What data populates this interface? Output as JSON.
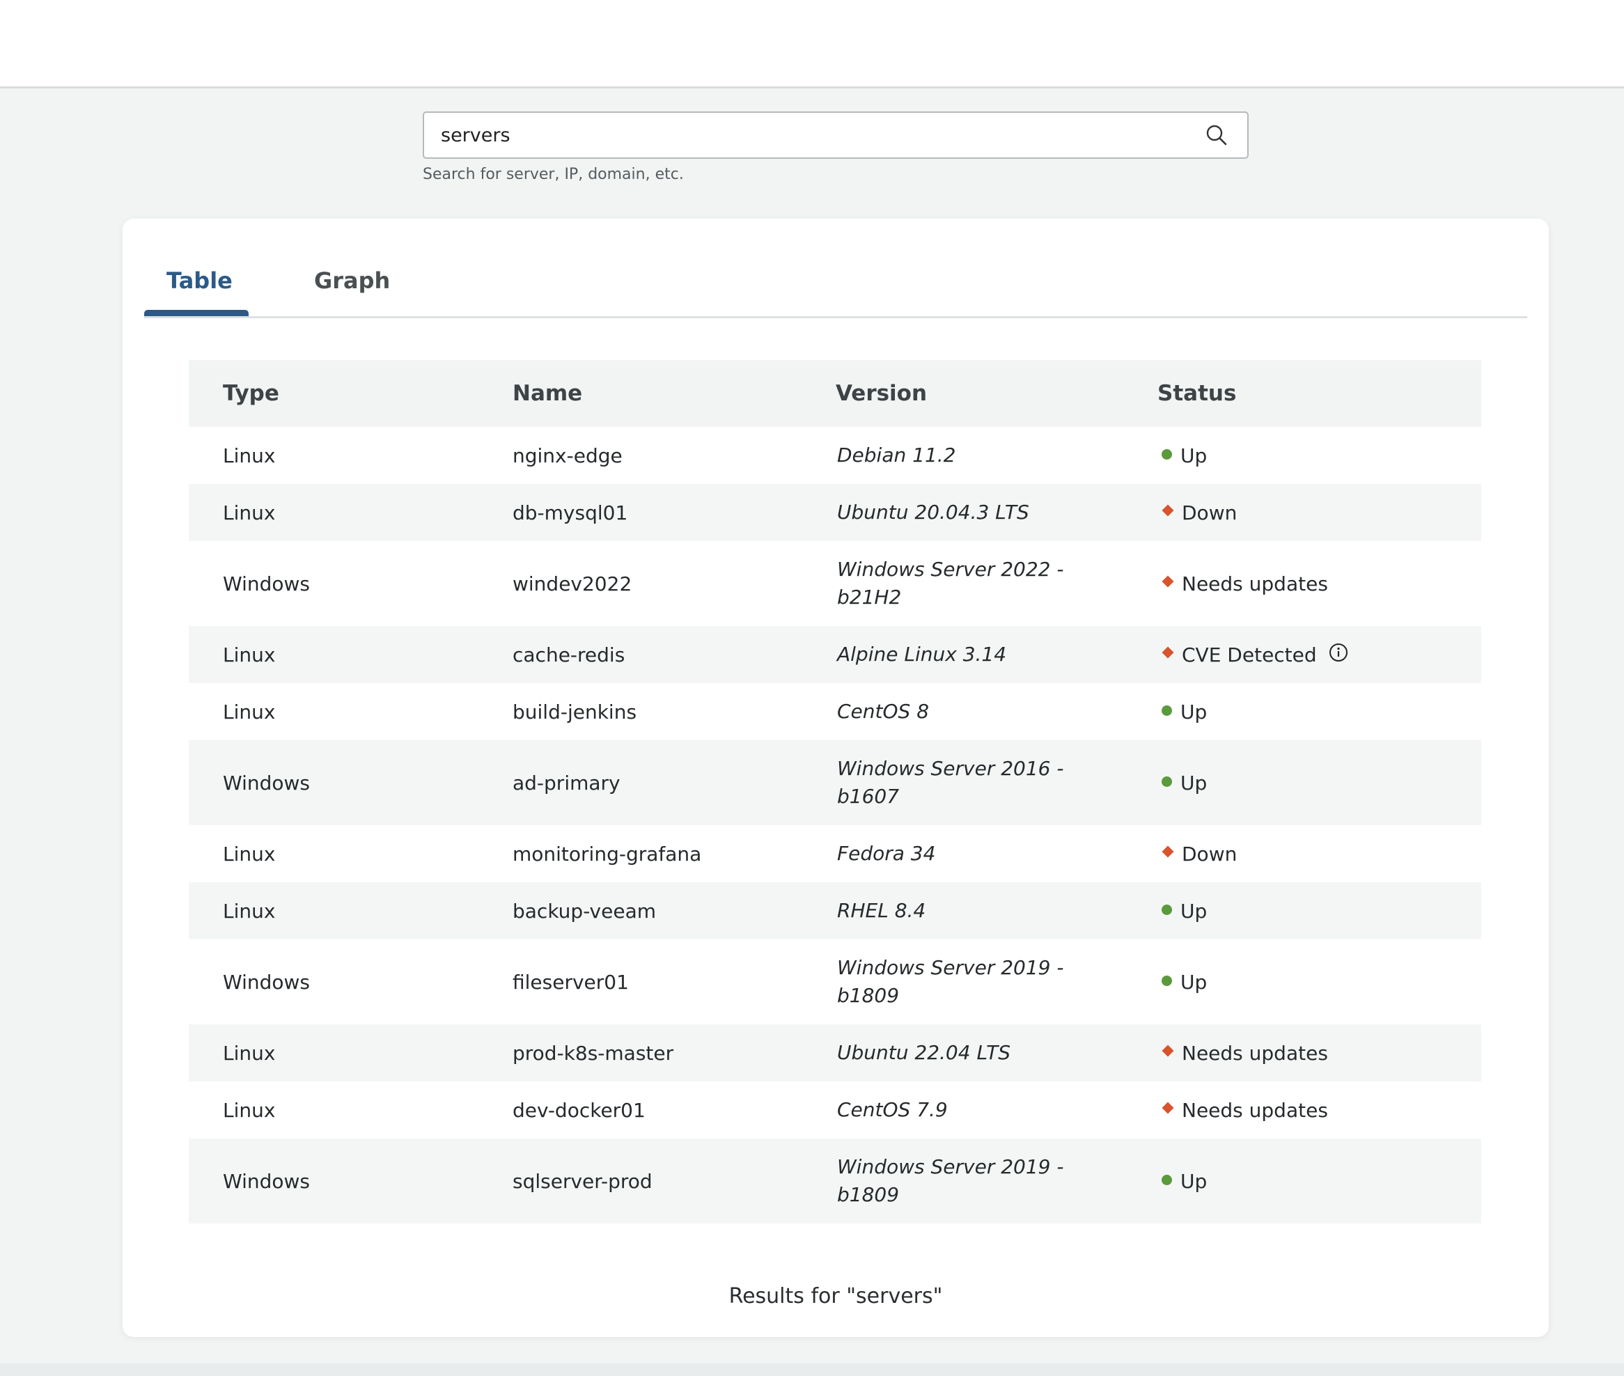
{
  "search": {
    "value": "servers",
    "helper": "Search for server, IP, domain, etc."
  },
  "tabs": {
    "table": "Table",
    "graph": "Graph",
    "active": "Table"
  },
  "table": {
    "headers": {
      "type": "Type",
      "name": "Name",
      "version": "Version",
      "status": "Status"
    },
    "rows": [
      {
        "type": "Linux",
        "name": "nginx-edge",
        "version": "Debian 11.2",
        "status": "Up"
      },
      {
        "type": "Linux",
        "name": "db-mysql01",
        "version": "Ubuntu 20.04.3 LTS",
        "status": "Down"
      },
      {
        "type": "Windows",
        "name": "windev2022",
        "version": "Windows Server 2022 - b21H2",
        "status": "Needs updates"
      },
      {
        "type": "Linux",
        "name": "cache-redis",
        "version": "Alpine Linux 3.14",
        "status": "CVE Detected"
      },
      {
        "type": "Linux",
        "name": "build-jenkins",
        "version": "CentOS 8",
        "status": "Up"
      },
      {
        "type": "Windows",
        "name": "ad-primary",
        "version": "Windows Server 2016 - b1607",
        "status": "Up"
      },
      {
        "type": "Linux",
        "name": "monitoring-grafana",
        "version": "Fedora 34",
        "status": "Down"
      },
      {
        "type": "Linux",
        "name": "backup-veeam",
        "version": "RHEL 8.4",
        "status": "Up"
      },
      {
        "type": "Windows",
        "name": "fileserver01",
        "version": "Windows Server 2019 - b1809",
        "status": "Up"
      },
      {
        "type": "Linux",
        "name": "prod-k8s-master",
        "version": "Ubuntu 22.04 LTS",
        "status": "Needs updates"
      },
      {
        "type": "Linux",
        "name": "dev-docker01",
        "version": "CentOS 7.9",
        "status": "Needs updates"
      },
      {
        "type": "Windows",
        "name": "sqlserver-prod",
        "version": "Windows Server 2019 - b1809",
        "status": "Up"
      }
    ]
  },
  "results_text": "Results for \"servers\"",
  "colors": {
    "accent": "#2c5a87",
    "status_ok": "#5a9a3c",
    "status_alert": "#d9532c"
  },
  "icons": {
    "search": "search-icon",
    "info": "info-icon",
    "status_ok": "status-dot-icon",
    "status_alert": "status-diamond-icon"
  }
}
